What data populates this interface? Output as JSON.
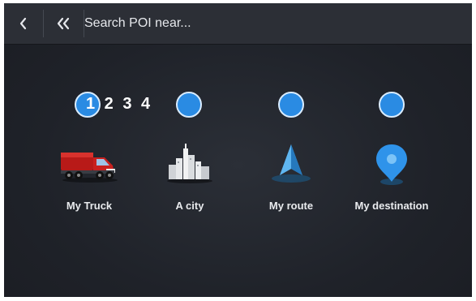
{
  "topbar": {
    "back_icon": "chevron-left-icon",
    "first_icon": "double-chevron-left-icon",
    "search_placeholder": "Search POI near..."
  },
  "steps_label": "1 2 3 4",
  "pois": [
    {
      "label": "My Truck",
      "icon": "truck-icon"
    },
    {
      "label": "A city",
      "icon": "city-icon"
    },
    {
      "label": "My route",
      "icon": "route-arrow-icon"
    },
    {
      "label": "My destination",
      "icon": "destination-pin-icon"
    }
  ],
  "colors": {
    "background": "#1e2128",
    "topbar": "#2c2f36",
    "accent_blue": "#2a8be3",
    "truck_red": "#c8201e"
  }
}
